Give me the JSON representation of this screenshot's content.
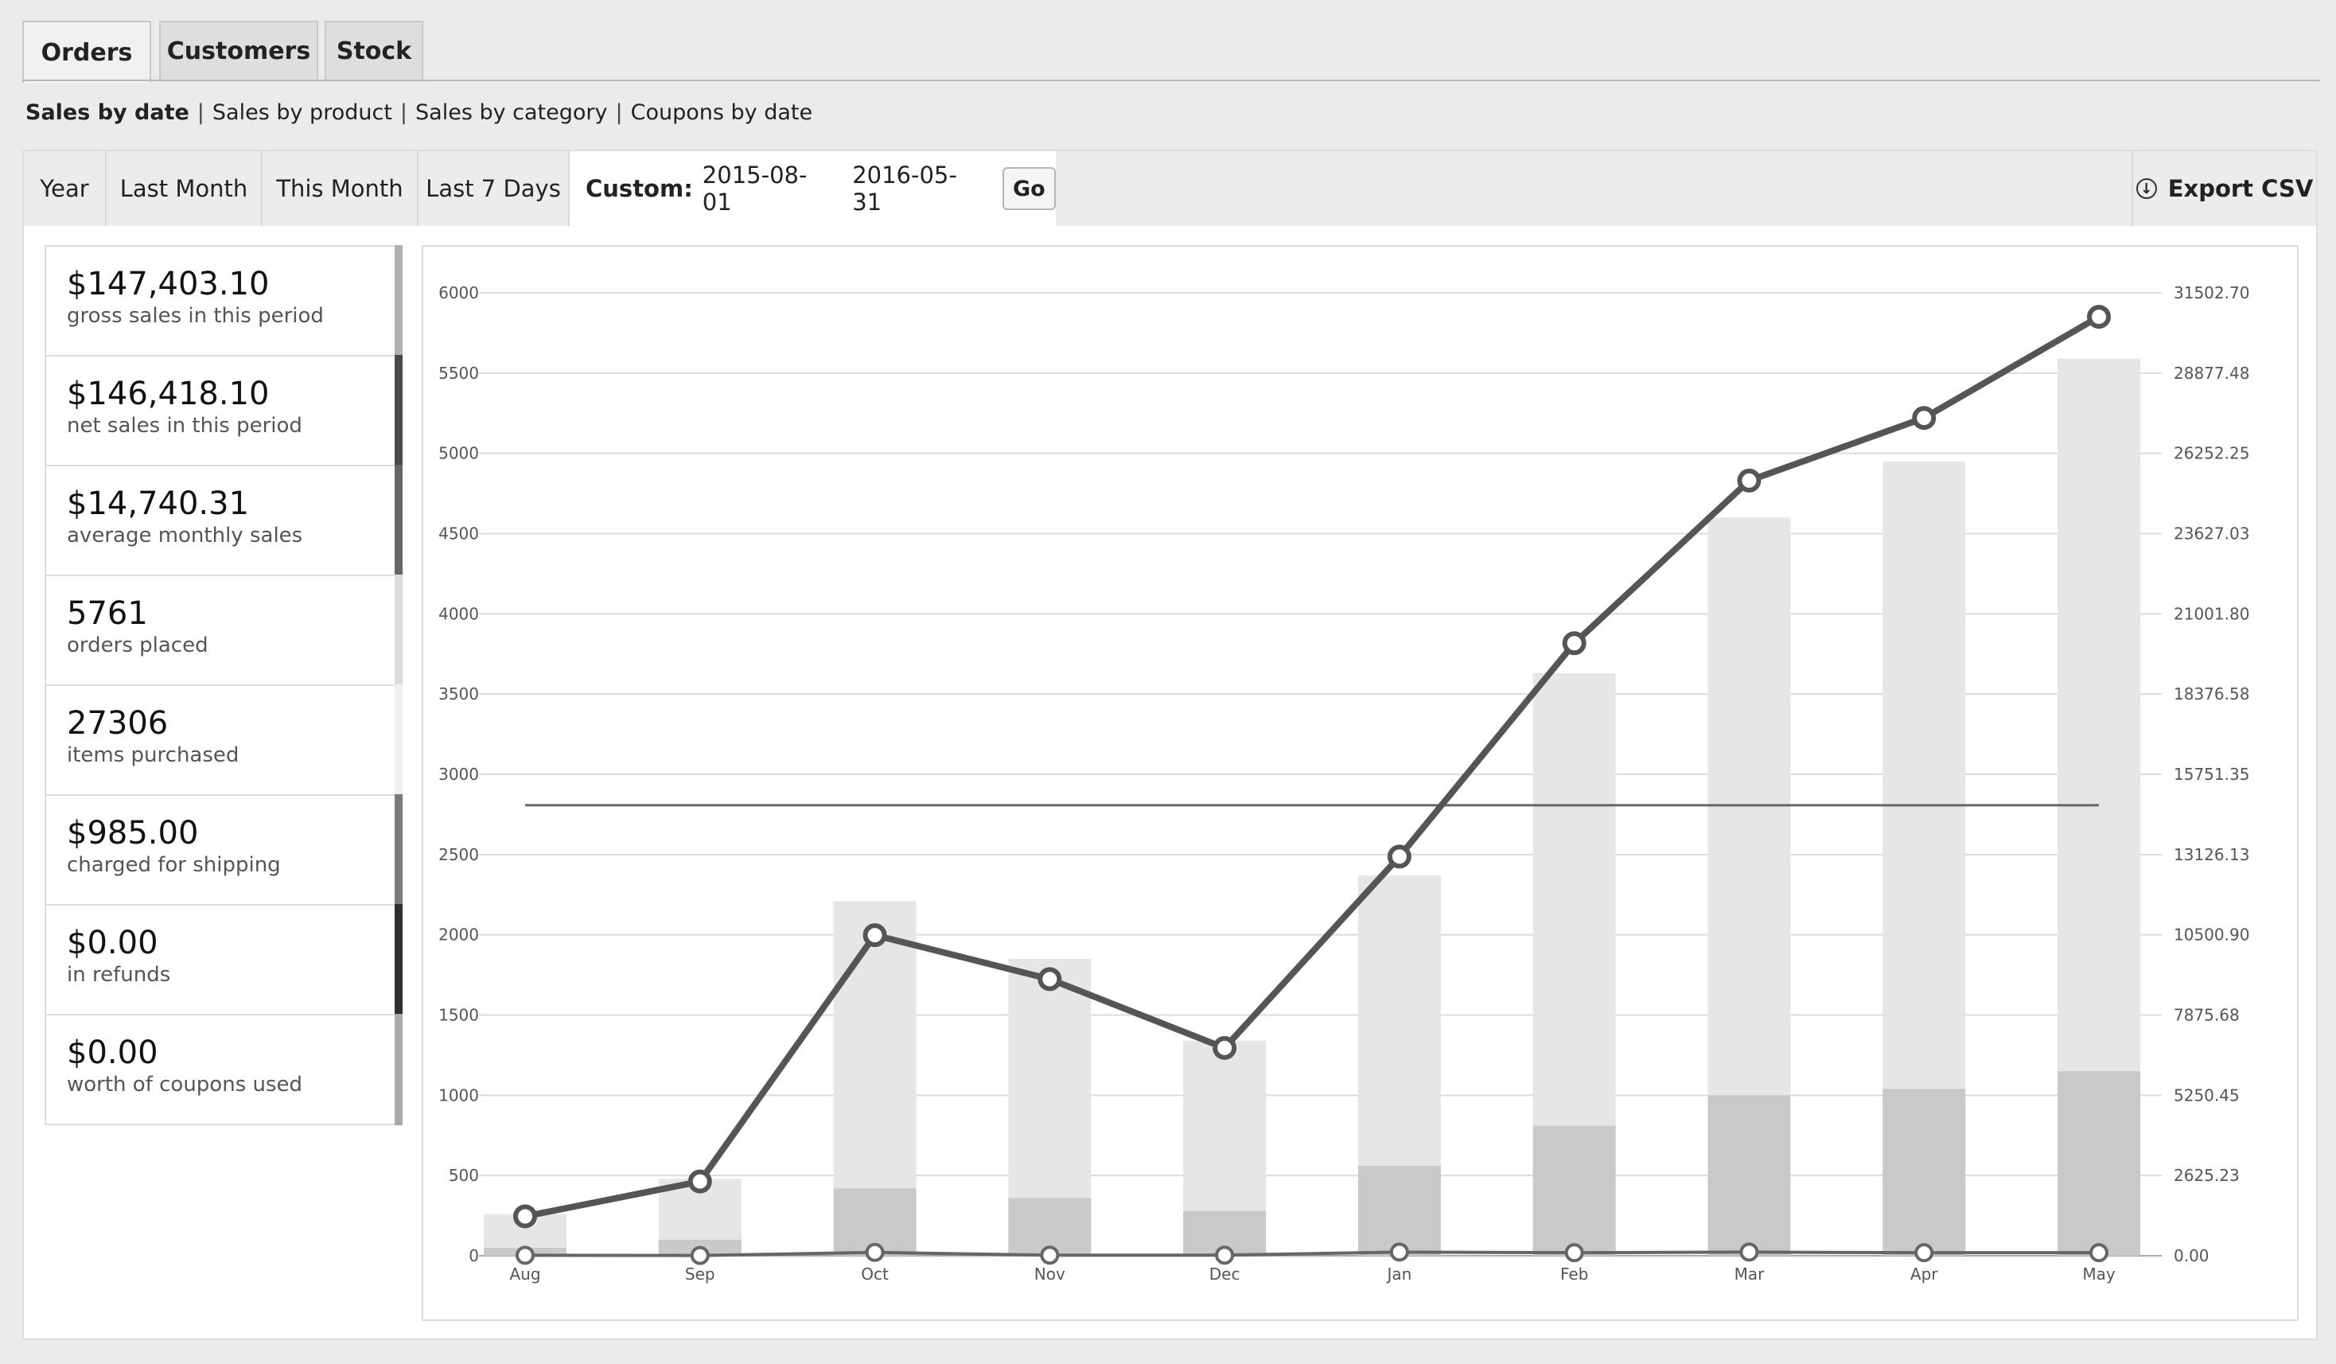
{
  "tabs": [
    {
      "label": "Orders",
      "active": true
    },
    {
      "label": "Customers",
      "active": false
    },
    {
      "label": "Stock",
      "active": false
    }
  ],
  "subnav": {
    "items": [
      "Sales by date",
      "Sales by product",
      "Sales by category",
      "Coupons by date"
    ],
    "separator": "|"
  },
  "range": {
    "buttons": [
      "Year",
      "Last Month",
      "This Month",
      "Last 7 Days"
    ],
    "custom_label": "Custom:",
    "start_date": "2015-08-01",
    "end_date": "2016-05-31",
    "go_label": "Go",
    "export_label": "Export CSV"
  },
  "stats": [
    {
      "value": "$147,403.10",
      "label": "gross sales in this period",
      "color": "#b1b1b1"
    },
    {
      "value": "$146,418.10",
      "label": "net sales in this period",
      "color": "#4a4a4a"
    },
    {
      "value": "$14,740.31",
      "label": "average monthly sales",
      "color": "#666666"
    },
    {
      "value": "5761",
      "label": "orders placed",
      "color": "#dcdcdc"
    },
    {
      "value": "27306",
      "label": "items purchased",
      "color": "#f0f0f0"
    },
    {
      "value": "$985.00",
      "label": "charged for shipping",
      "color": "#7a7a7a"
    },
    {
      "value": "$0.00",
      "label": "in refunds",
      "color": "#2f2f2f"
    },
    {
      "value": "$0.00",
      "label": "worth of coupons used",
      "color": "#a9a9a9"
    }
  ],
  "chart_data": {
    "type": "bar",
    "categories": [
      "Aug",
      "Sep",
      "Oct",
      "Nov",
      "Dec",
      "Jan",
      "Feb",
      "Mar",
      "Apr",
      "May"
    ],
    "y_left_ticks": [
      "0",
      "500",
      "1000",
      "1500",
      "2000",
      "2500",
      "3000",
      "3500",
      "4000",
      "4500",
      "5000",
      "5500",
      "6000"
    ],
    "y_right_ticks": [
      "0.00",
      "2625.23",
      "5250.45",
      "7875.68",
      "10500.90",
      "13126.13",
      "15751.35",
      "18376.58",
      "21001.80",
      "23627.03",
      "26252.25",
      "28877.48",
      "31502.70"
    ],
    "ylim_left": [
      0,
      6000
    ],
    "ylim_right": [
      0,
      31502.7
    ],
    "series": [
      {
        "values": [
          260,
          480,
          2210,
          1850,
          1340,
          2370,
          3630,
          4600,
          4950,
          5590
        ],
        "color": "#e6e6e6",
        "kind": "bar"
      },
      {
        "values": [
          50,
          100,
          420,
          360,
          280,
          560,
          810,
          1000,
          1040,
          1150
        ],
        "color": "#c9c9c9",
        "kind": "bar"
      },
      {
        "values": [
          1290,
          2430,
          10490,
          9050,
          6800,
          13060,
          20040,
          25360,
          27410,
          30720
        ],
        "color": "#555555",
        "kind": "line",
        "axis": "right"
      },
      {
        "values": [
          15,
          10,
          110,
          20,
          20,
          120,
          100,
          120,
          100,
          100
        ],
        "color": "#666666",
        "kind": "line",
        "axis": "right"
      },
      {
        "values": [
          14740.31
        ],
        "color": "#666666",
        "kind": "average",
        "axis": "right"
      }
    ],
    "grid": true
  }
}
